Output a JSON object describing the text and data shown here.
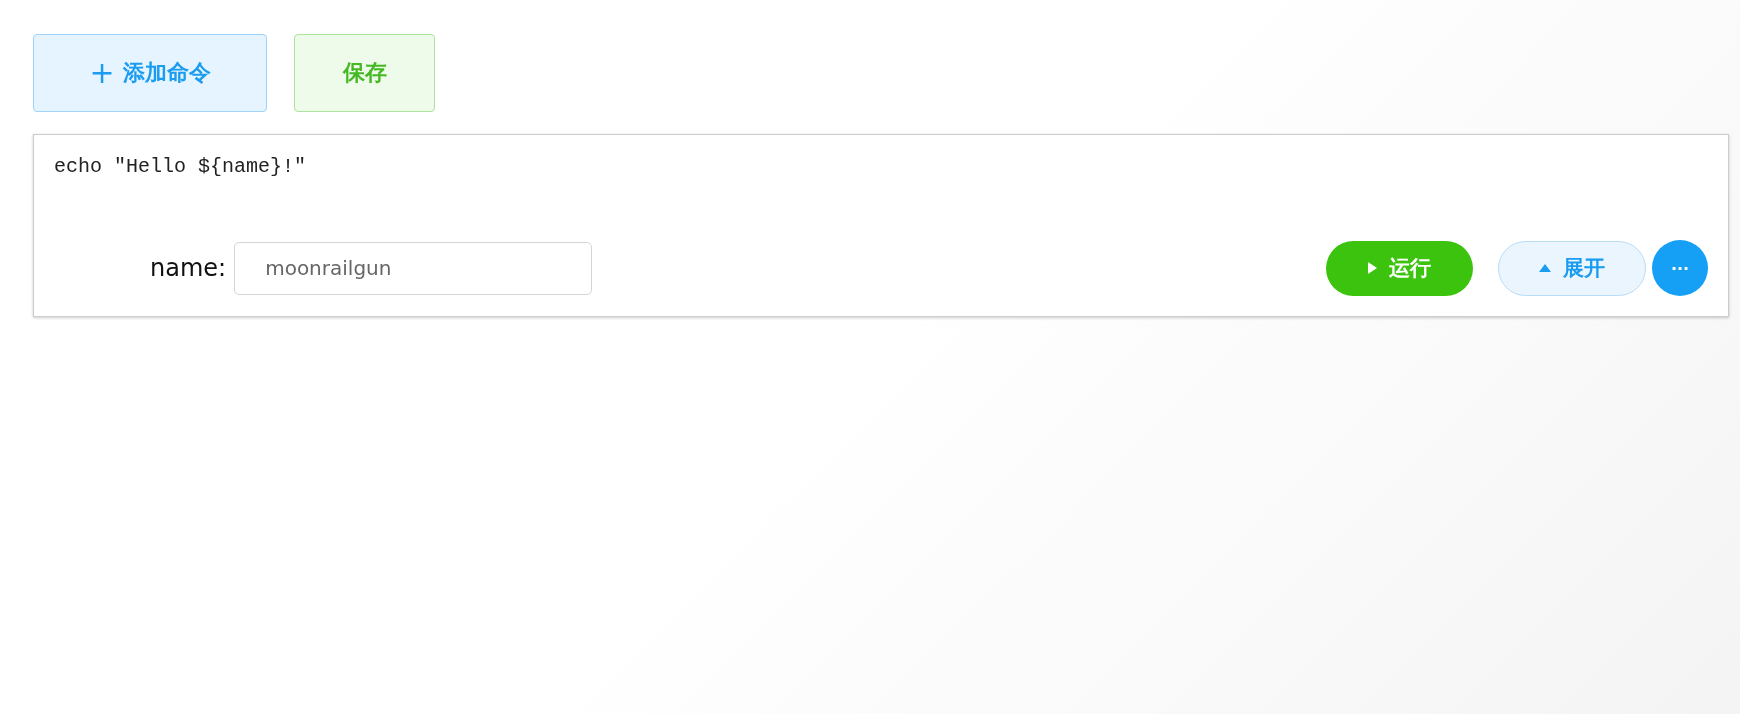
{
  "toolbar": {
    "buttons": [
      {
        "kind": "add",
        "icon": "+",
        "label": "添加命令"
      },
      {
        "kind": "save",
        "label": "保存"
      }
    ]
  },
  "command_card": {
    "code": "echo \"Hello ${name}!\"",
    "params": [
      {
        "label": "name:",
        "value": "moonrailgun"
      }
    ],
    "run_button": {
      "label": "运行"
    },
    "expand_button": {
      "label": "展开",
      "expanded": false
    },
    "more_button": {
      "label": "···"
    }
  }
}
